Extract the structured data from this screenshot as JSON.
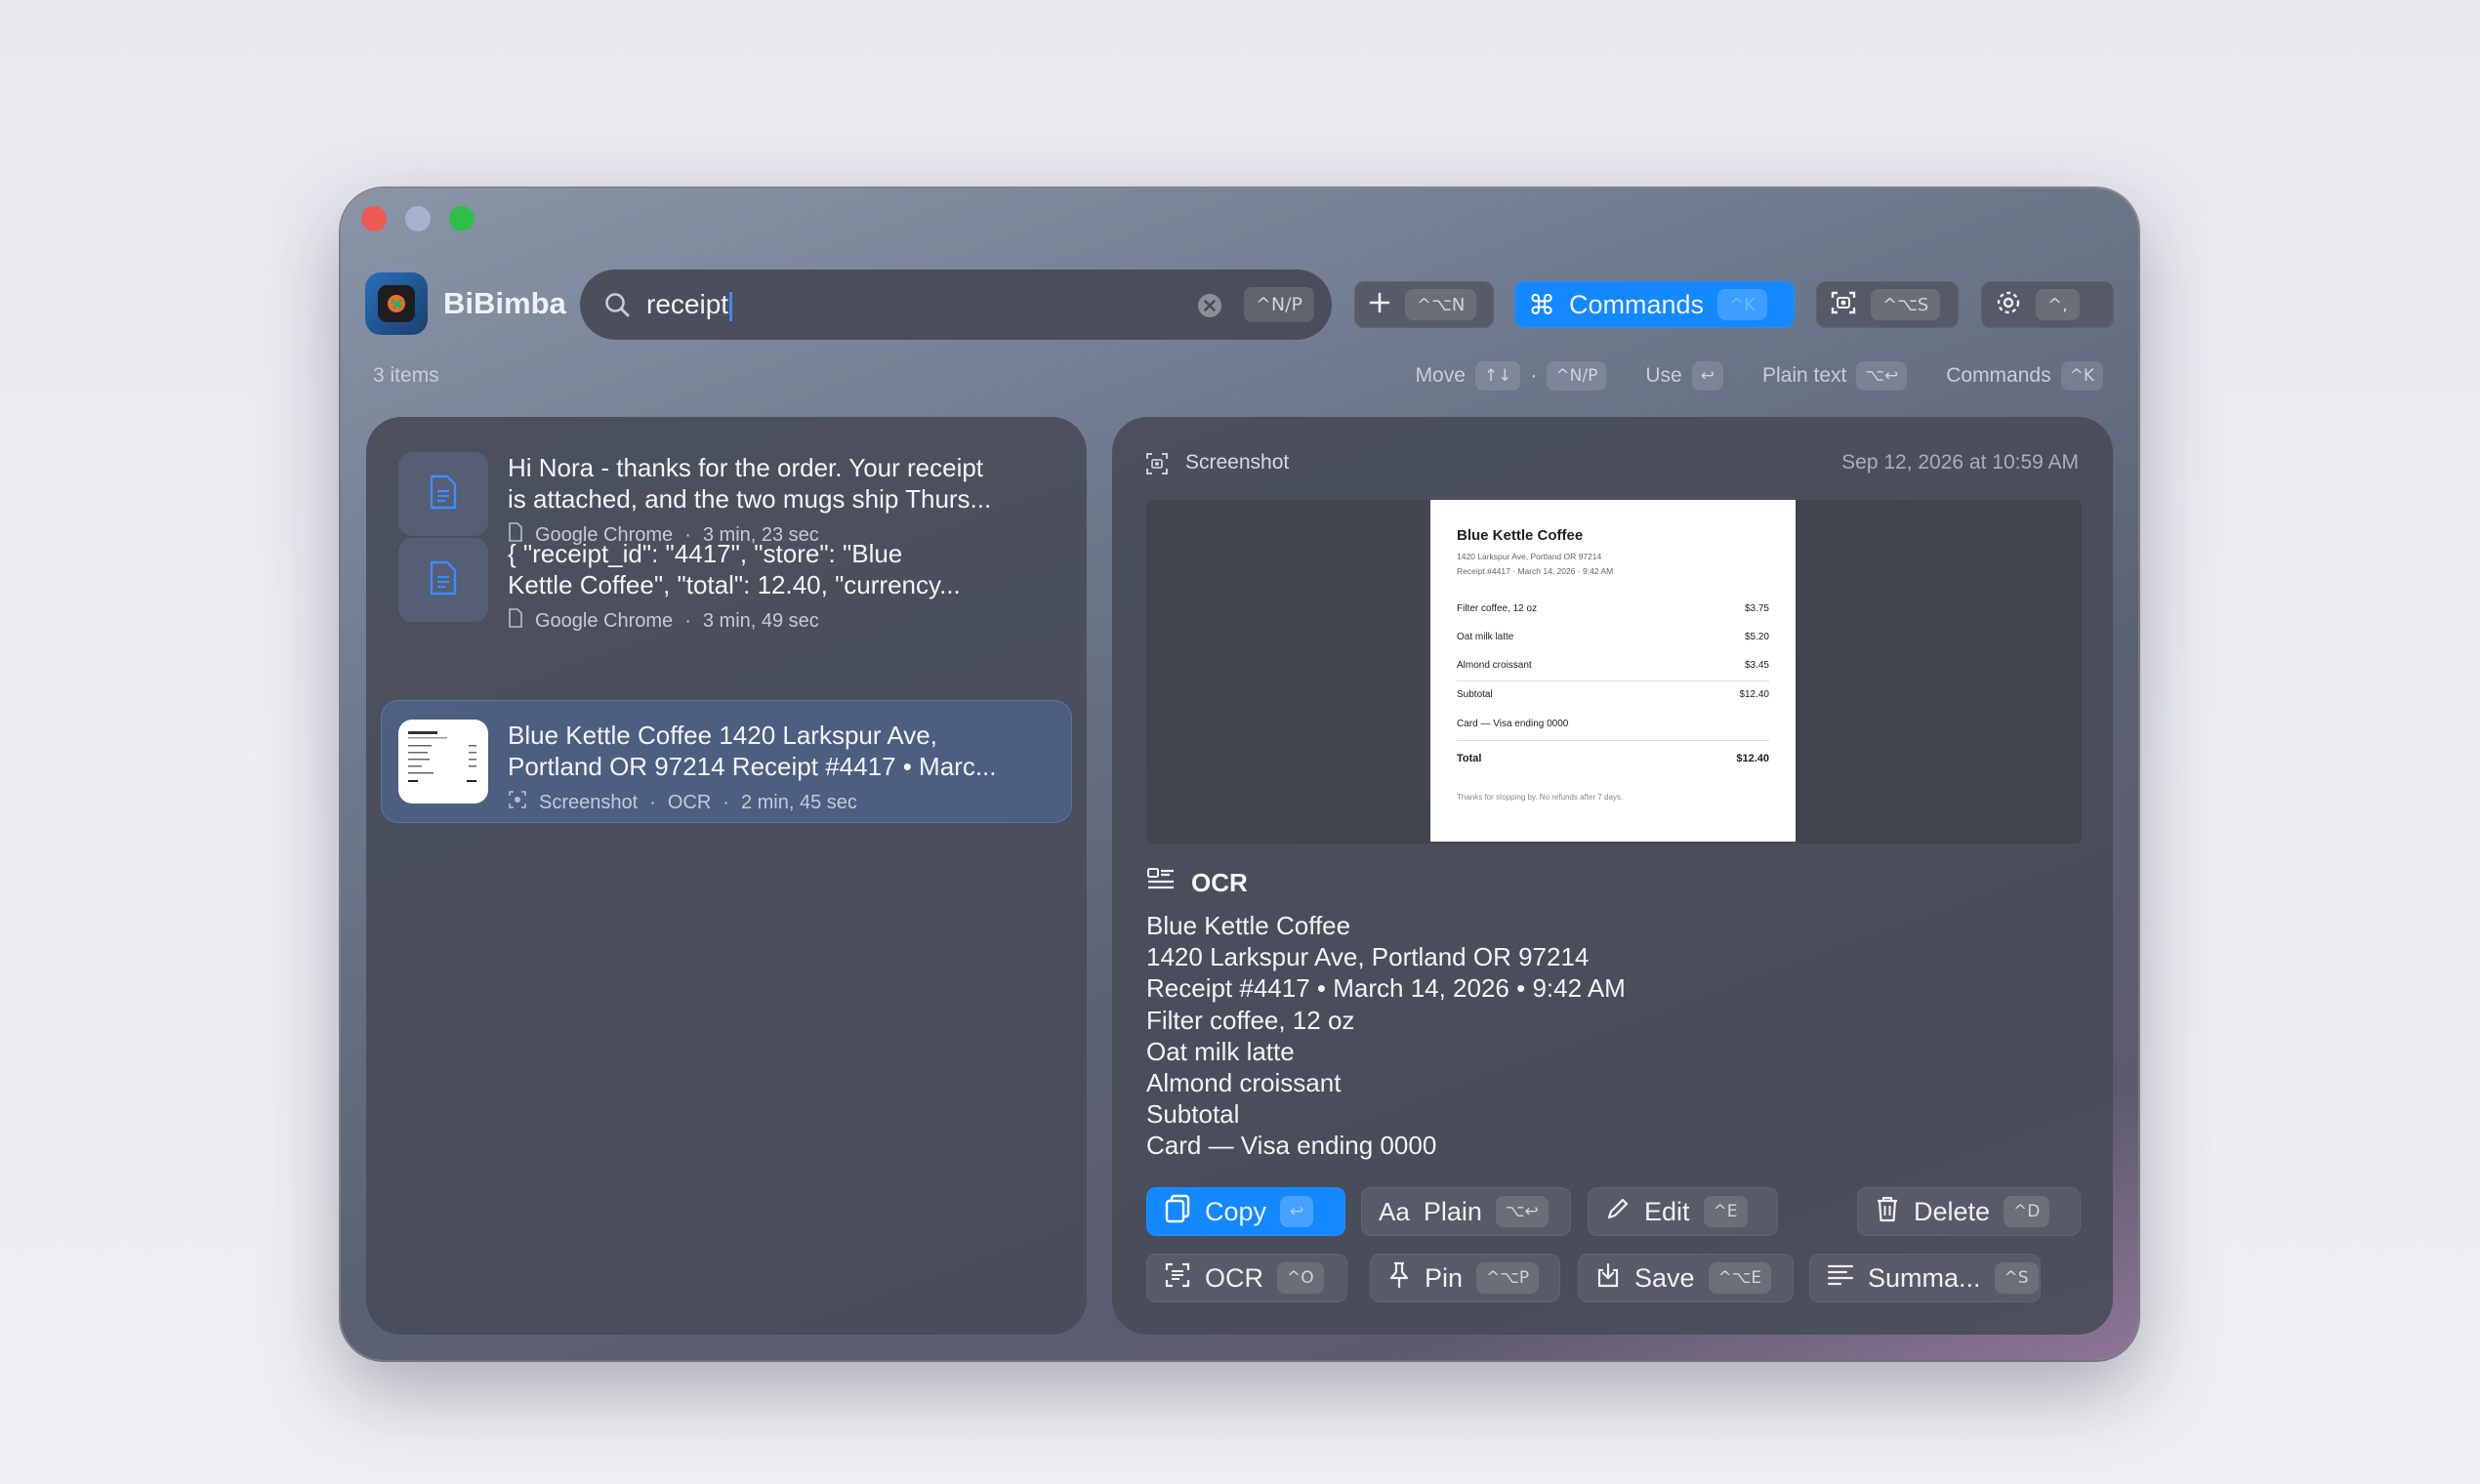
{
  "app": {
    "name": "BiBimba"
  },
  "search": {
    "value": "receipt",
    "shortcut": "^N/P"
  },
  "toolbar": {
    "new_shortcut": "^⌥N",
    "commands_label": "Commands",
    "commands_shortcut": "^K",
    "screenshot_shortcut": "^⌥S",
    "settings_shortcut": "^,"
  },
  "status": {
    "count": "3 items",
    "hints": [
      {
        "label": "Move",
        "keys": [
          "↑↓",
          "^N/P"
        ]
      },
      {
        "label": "Use",
        "keys": [
          "↩"
        ]
      },
      {
        "label": "Plain text",
        "keys": [
          "⌥↩"
        ]
      },
      {
        "label": "Commands",
        "keys": [
          "^K"
        ]
      }
    ]
  },
  "items": [
    {
      "title_line1": "Hi Nora - thanks for the order. Your receipt",
      "title_line2": "is attached, and the two mugs ship Thurs...",
      "source": "Google Chrome",
      "age": "3 min, 23 sec",
      "kind_icon": "document-icon"
    },
    {
      "title_line1": "{   \"receipt_id\": \"4417\",   \"store\": \"Blue",
      "title_line2": "Kettle Coffee\",   \"total\": 12.40,   \"currency...",
      "source": "Google Chrome",
      "age": "3 min, 49 sec",
      "kind_icon": "document-icon"
    },
    {
      "title_line1": "Blue Kettle Coffee 1420 Larkspur Ave,",
      "title_line2": "Portland OR 97214 Receipt #4417 • Marc...",
      "source": "Screenshot",
      "tag": "OCR",
      "age": "2 min, 45 sec",
      "kind_icon": "screenshot-icon"
    }
  ],
  "detail": {
    "type_label": "Screenshot",
    "timestamp": "Sep 12, 2026 at 10:59 AM",
    "receipt": {
      "store": "Blue Kettle Coffee",
      "address": "1420 Larkspur Ave, Portland OR 97214",
      "meta": "Receipt #4417 · March 14, 2026 · 9:42 AM",
      "lines": [
        {
          "item": "Filter coffee, 12 oz",
          "price": "$3.75"
        },
        {
          "item": "Oat milk latte",
          "price": "$5.20"
        },
        {
          "item": "Almond croissant",
          "price": "$3.45"
        },
        {
          "item": "Subtotal",
          "price": "$12.40"
        },
        {
          "item": "Card — Visa ending 0000",
          "price": ""
        },
        {
          "item": "Total",
          "price": "$12.40"
        }
      ],
      "footer": "Thanks for stopping by. No refunds after 7 days."
    },
    "ocr_heading": "OCR",
    "ocr_lines": [
      "Blue Kettle Coffee",
      "1420 Larkspur Ave, Portland OR 97214",
      "Receipt #4417 • March 14, 2026 • 9:42 AM",
      "Filter coffee, 12 oz",
      "Oat milk latte",
      "Almond croissant",
      "Subtotal",
      "Card — Visa ending 0000"
    ]
  },
  "actions": {
    "copy": {
      "label": "Copy",
      "shortcut": "↩"
    },
    "plain": {
      "label": "Plain",
      "shortcut": "⌥↩"
    },
    "edit": {
      "label": "Edit",
      "shortcut": "^E"
    },
    "delete": {
      "label": "Delete",
      "shortcut": "^D"
    },
    "ocr": {
      "label": "OCR",
      "shortcut": "^O"
    },
    "pin": {
      "label": "Pin",
      "shortcut": "^⌥P"
    },
    "save": {
      "label": "Save",
      "shortcut": "^⌥E"
    },
    "summarize": {
      "label": "Summa...",
      "shortcut": "^S"
    }
  },
  "colors": {
    "accent": "#1488ff",
    "close": "#ec5a52",
    "zoom": "#2fbe4a"
  }
}
